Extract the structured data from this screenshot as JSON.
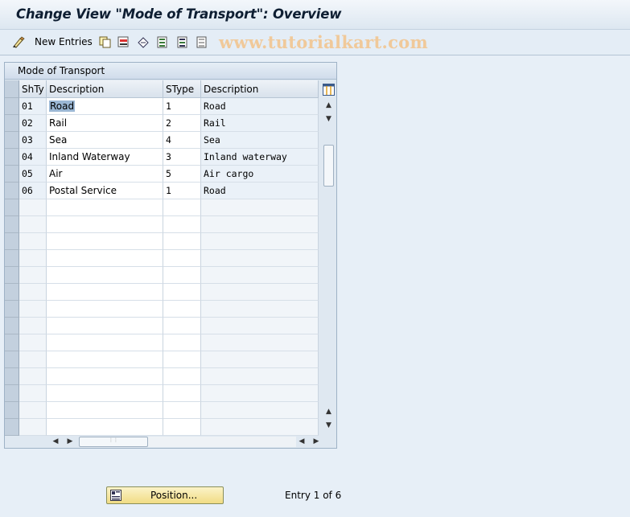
{
  "window": {
    "title": "Change View \"Mode of Transport\": Overview"
  },
  "toolbar": {
    "new_entries_label": "New Entries",
    "watermark": "www.tutorialkart.com",
    "icons": [
      "display-change-icon",
      "copy-as-icon",
      "delete-icon",
      "undo-change-icon",
      "select-all-icon",
      "select-block-icon",
      "deselect-all-icon"
    ]
  },
  "table": {
    "title": "Mode of Transport",
    "columns": [
      "ShTy",
      "Description",
      "SType",
      "Description"
    ],
    "rows": [
      [
        "01",
        "Road",
        "1",
        "Road"
      ],
      [
        "02",
        "Rail",
        "2",
        "Rail"
      ],
      [
        "03",
        "Sea",
        "4",
        "Sea"
      ],
      [
        "04",
        "Inland Waterway",
        "3",
        "Inland waterway"
      ],
      [
        "05",
        "Air",
        "5",
        "Air cargo"
      ],
      [
        "06",
        "Postal Service",
        "1",
        "Road"
      ]
    ],
    "empty_rows": 14
  },
  "footer": {
    "position_label": "Position...",
    "entry_text": "Entry 1 of 6"
  },
  "colors": {
    "accent": "#9bb7d4",
    "button_bg": "#f1dc84",
    "background": "#e7eff7"
  }
}
